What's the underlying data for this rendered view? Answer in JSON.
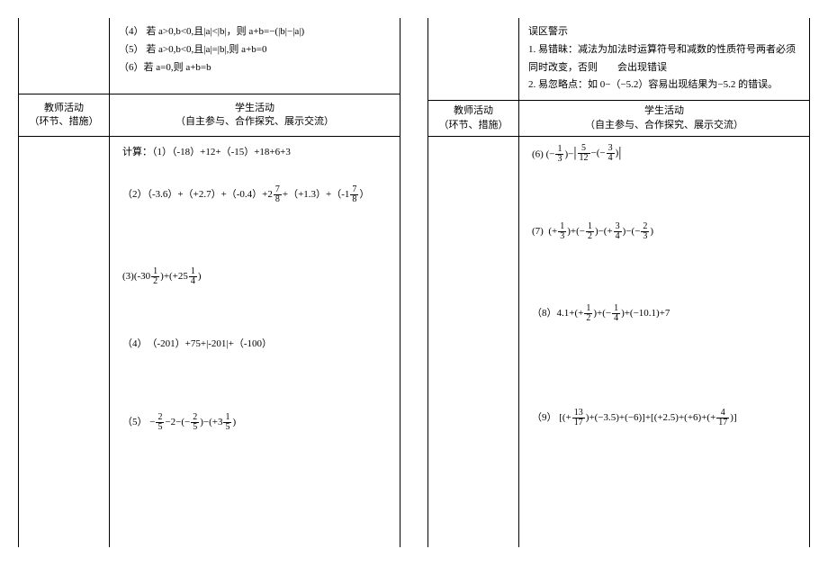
{
  "left": {
    "top_rules": {
      "r4": "（4） 若 a>0,b<0,且|a|<|b|，则 a+b=−(|b|−|a|)",
      "r5": "（5） 若 a>0,b<0,且|a|=|b|,则 a+b=0",
      "r6": "（6）若 a=0,则 a+b=b"
    },
    "header": {
      "left1": "教师活动",
      "left2": "（环节、措施）",
      "right1": "学生活动",
      "right2": "（自主参与、合作探究、展示交流）"
    },
    "problems": {
      "p1_label": "计算：（1）",
      "p1": "（-18）+12+（-15）+18+6+3",
      "p2_label": "（2）",
      "p2a": "（-3.6）+（+2.7）+（-0.4）+",
      "p2_f1n": "7",
      "p2_f1d": "8",
      "p2_f1w": "2",
      "p2b": "+（+1.3）+（-",
      "p2_f2n": "7",
      "p2_f2d": "8",
      "p2_f2w": "1",
      "p2c": "）",
      "p3_label": "(3)",
      "p3a": "(-30",
      "p3_f1n": "1",
      "p3_f1d": "2",
      "p3b": ")+(+25",
      "p3_f2n": "1",
      "p3_f2d": "4",
      "p3c": ")",
      "p4_label": "（4）",
      "p4": "（-201）+75+|-201|+（-100）",
      "p5_label": "（5）",
      "p5a": "−",
      "p5_f1n": "2",
      "p5_f1d": "5",
      "p5b": "−2−(−",
      "p5_f2n": "2",
      "p5_f2d": "5",
      "p5c": ")−(+3",
      "p5_f3n": "1",
      "p5_f3d": "5",
      "p5d": ")"
    }
  },
  "right": {
    "top_box": {
      "title": "误区警示",
      "line1": "1. 易错昧：减法为加法时运算符号和减数的性质符号两者必须同时改变，否则　　会出现错误",
      "line2": "2. 易忽略点：如 0−（−5.2）容易出现结果为−5.2 的错误。"
    },
    "header": {
      "left1": "教师活动",
      "left2": "（环节、措施）",
      "right1": "学生活动",
      "right2": "（自主参与、合作探究、展示交流）"
    },
    "problems": {
      "p6_label": "(6)",
      "p6a": "(−",
      "p6_f1n": "1",
      "p6_f1d": "3",
      "p6b": ")−",
      "p6_f2n": "5",
      "p6_f2d": "12",
      "p6c": "−(−",
      "p6_f3n": "3",
      "p6_f3d": "4",
      "p6d": ")",
      "p7_label": "(7)",
      "p7a": "(+",
      "p7_f1n": "1",
      "p7_f1d": "3",
      "p7b": ")+(−",
      "p7_f2n": "1",
      "p7_f2d": "2",
      "p7c": ")−(+",
      "p7_f3n": "3",
      "p7_f3d": "4",
      "p7d": ")−(−",
      "p7_f4n": "2",
      "p7_f4d": "3",
      "p7e": ")",
      "p8_label": "（8）",
      "p8a": "4.1+(+",
      "p8_f1n": "1",
      "p8_f1d": "2",
      "p8b": ")+(−",
      "p8_f2n": "1",
      "p8_f2d": "4",
      "p8c": ")+(−10.1)+7",
      "p9_label": "（9）",
      "p9a": "[(+",
      "p9_f1n": "13",
      "p9_f1d": "17",
      "p9b": ")+(−3.5)+(−6)]+[(+2.5)+(+6)+(+",
      "p9_f2n": "4",
      "p9_f2d": "17",
      "p9c": ")]"
    }
  }
}
